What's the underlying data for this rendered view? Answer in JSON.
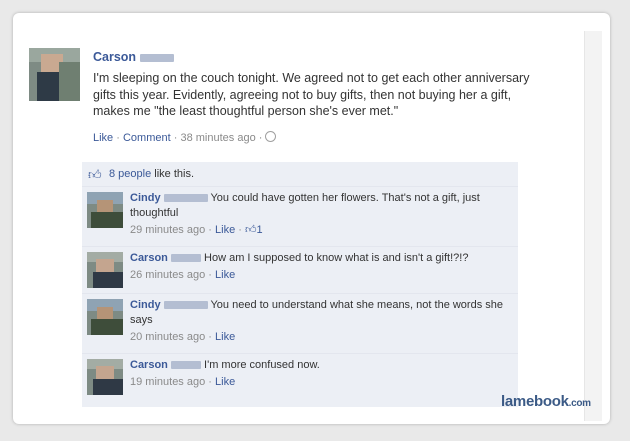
{
  "post": {
    "author": "Carson",
    "text": "I'm sleeping on the couch tonight. We agreed not to get each other anniversary gifts this year. Evidently, agreeing not to buy gifts, then not buying her a gift, makes me \"the least thoughtful person she's ever met.\"",
    "like_label": "Like",
    "comment_label": "Comment",
    "time": "38 minutes ago",
    "sep": "·"
  },
  "likes": {
    "count_text": "8 people",
    "suffix": "like this."
  },
  "comments": [
    {
      "author": "Cindy",
      "text": "You could have gotten her flowers. That's not a gift, just thoughtful",
      "time": "29 minutes ago",
      "like_label": "Like",
      "like_count": "1"
    },
    {
      "author": "Carson",
      "text": "How am I supposed to know what is and isn't a gift!?!?",
      "time": "26 minutes ago",
      "like_label": "Like"
    },
    {
      "author": "Cindy",
      "text": "You need to understand what she means, not the words she says",
      "time": "20 minutes ago",
      "like_label": "Like"
    },
    {
      "author": "Carson",
      "text": "I'm more confused now.",
      "time": "19 minutes ago",
      "like_label": "Like"
    }
  ],
  "watermark": {
    "brand": "lamebook",
    "tld": ".com"
  },
  "colors": {
    "link": "#3b5998",
    "panel_bg": "#eceff5",
    "text": "#333333"
  }
}
